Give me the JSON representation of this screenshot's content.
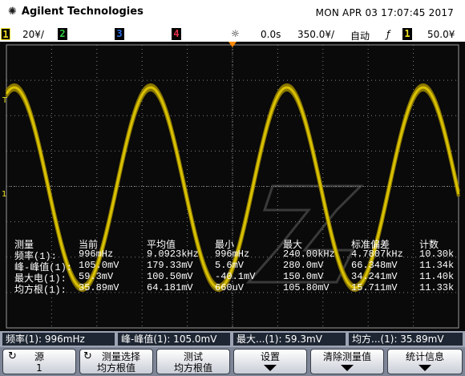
{
  "header": {
    "brand": "Agilent Technologies",
    "datetime": "MON APR 03 17:07:45 2017"
  },
  "channel_bar": {
    "ch1_num": "1",
    "ch1_scale": "20¥/",
    "ch2_num": "2",
    "ch3_num": "3",
    "ch4_num": "4",
    "time_delay": "0.0s",
    "time_scale": "350.0¥/",
    "trigger_mode": "自动",
    "trigger_slope": "ƒ",
    "trigger_src": "1",
    "trigger_level": "50.0¥",
    "colors": {
      "ch1": "#f0e020",
      "ch2": "#2ecc40",
      "ch3": "#2d6fe6",
      "ch4": "#e8304a"
    }
  },
  "screen": {
    "grid_color": "#808080",
    "trace_color": "#d8c100",
    "trace_cycles": 3,
    "ch1_marker": "1",
    "trigger_marker": "T"
  },
  "measurements": {
    "headers": [
      "测量",
      "当前",
      "平均值",
      "最小",
      "最大",
      "标准偏差",
      "计数"
    ],
    "rows": [
      [
        "频率(1):",
        "996mHz",
        "9.0923kHz",
        "996mHz",
        "240.00kHz",
        "4.7807kHz",
        "10.30k"
      ],
      [
        "峰-峰值(1):",
        "105.0mV",
        "179.33mV",
        "5.6mV",
        "280.0mV",
        "66.348mV",
        "11.34k"
      ],
      [
        "最大电(1):",
        "59.3mV",
        "100.50mV",
        "-40.1mV",
        "150.0mV",
        "34.241mV",
        "11.40k"
      ],
      [
        "均方根(1):",
        "35.89mV",
        "64.181mV",
        "660uV",
        "105.80mV",
        "15.711mV",
        "11.33k"
      ]
    ]
  },
  "mstrip": [
    "频率(1): 996mHz",
    "峰-峰值(1): 105.0mV",
    "最大...(1): 59.3mV",
    "均方...(1): 35.89mV"
  ],
  "softkeys": {
    "source_label": "源",
    "source_value": "1",
    "select_line1": "测量选择",
    "select_line2": "均方根值",
    "test_line1": "测试",
    "test_line2": "均方根值",
    "settings": "设置",
    "clear": "清除测量值",
    "stats": "统计信息"
  }
}
